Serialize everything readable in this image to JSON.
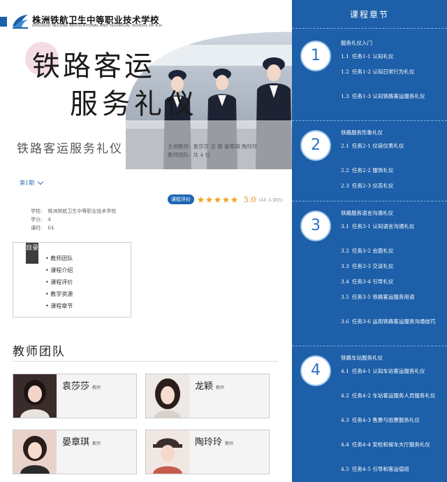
{
  "header": {
    "school_cn": "株洲铁航卫生中等职业技术学校",
    "school_en": "ZHUZHOU SECOND ARVOCATIONAL AND TECHNICAL SCHOOL OF R.H"
  },
  "hero": {
    "title_line1": "铁路客运",
    "title_line2": "服务礼仪",
    "subtitle": "铁路客运服务礼仪",
    "lecturer_label": "主讲教师:",
    "lecturer_names": "袁莎莎 龙 颖 晏章琪 陶玲玲",
    "team_label": "教师团队:",
    "team_value": "共 4 位"
  },
  "term": {
    "label": "第1期"
  },
  "evaluation": {
    "badge": "课程评价",
    "stars": 5,
    "score": "5.0",
    "count": "(44 人评价)",
    "star_color": "#f0a722"
  },
  "meta": {
    "school_label": "学校:",
    "school_value": "株洲铁航卫生中等职业技术学校",
    "credit_label": "学分:",
    "credit_value": "4",
    "hours_label": "课时:",
    "hours_value": "64"
  },
  "toc": {
    "tag": "目录",
    "items": [
      "教师团队",
      "课程介绍",
      "课程评价",
      "教学资源",
      "课程章节"
    ]
  },
  "team": {
    "title": "教师团队",
    "members": [
      {
        "name": "袁莎莎",
        "role": "教师"
      },
      {
        "name": "龙颖",
        "role": "教师"
      },
      {
        "name": "晏章琪",
        "role": "教师"
      },
      {
        "name": "陶玲玲",
        "role": "教师"
      }
    ]
  },
  "sidebar": {
    "title": "课程章节",
    "accent": "#1d5fa8",
    "chapters": [
      {
        "number": "1",
        "title": "服务礼仪入门",
        "tasks": [
          {
            "num": "1.1",
            "text": "任务1-1 认知礼仪"
          },
          {
            "num": "1.2",
            "text": "任务1-2 认知日常行为礼仪"
          },
          {
            "num": "1.3",
            "text": "任务1-3 认知铁路客运服务礼仪"
          }
        ]
      },
      {
        "number": "2",
        "title": "铁路服务形象礼仪",
        "tasks": [
          {
            "num": "2.1",
            "text": "任务2-1 仪容仪表礼仪"
          },
          {
            "num": "2.2",
            "text": "任务2-2 服饰礼仪"
          },
          {
            "num": "2.3",
            "text": "任务2-3 仪态礼仪"
          }
        ]
      },
      {
        "number": "3",
        "title": "铁路服务语言沟通礼仪",
        "tasks": [
          {
            "num": "3.1",
            "text": "任务3-1 认知语言沟通礼仪"
          },
          {
            "num": "3.2",
            "text": "任务3-2 会面礼仪"
          },
          {
            "num": "3.3",
            "text": "任务3-3 交谈礼仪"
          },
          {
            "num": "3.4",
            "text": "任务3-4 引导礼仪"
          },
          {
            "num": "3.5",
            "text": "任务3-5 铁路客运服务用语"
          },
          {
            "num": "3.6",
            "text": "任务3-6 运用铁路客运服务沟通技巧"
          }
        ]
      },
      {
        "number": "4",
        "title": "铁路车站服务礼仪",
        "tasks": [
          {
            "num": "4.1",
            "text": "任务4-1 认知车站客运服务礼仪"
          },
          {
            "num": "4.2",
            "text": "任务4-2 车站客运服务人员服务礼仪"
          },
          {
            "num": "4.3",
            "text": "任务4-3 售票与验票服务礼仪"
          },
          {
            "num": "4.4",
            "text": "任务4-4 安检和候车大厅服务礼仪"
          },
          {
            "num": "4.5",
            "text": "任务4-5 引导和客运值班"
          }
        ]
      }
    ]
  }
}
